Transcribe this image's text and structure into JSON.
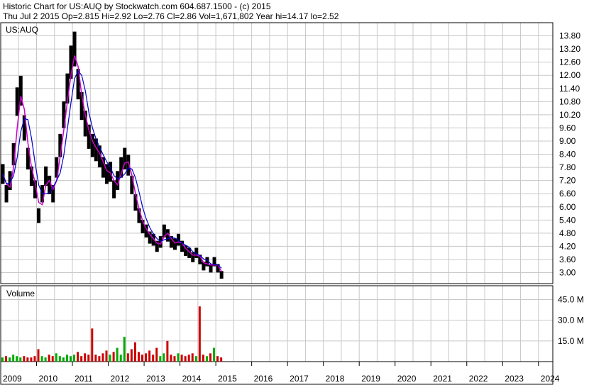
{
  "header": {
    "line1": "Historic Chart for US:AUQ by Stockwatch.com 604.687.1500 - (c) 2015",
    "line2": "Thu Jul  2 2015   Op=2.815   Hi=2.92   Lo=2.76   Cl=2.86   Vol=1,671,802   Year hi=14.17   lo=2.52"
  },
  "price_panel": {
    "symbol_label": "US:AUQ"
  },
  "volume_panel": {
    "title": "Volume"
  },
  "colors": {
    "price_bars": "#000000",
    "moving_average_short": "#cc00cc",
    "moving_average_long": "#0000cc",
    "volume_up": "#00aa00",
    "volume_down": "#cc0000",
    "grid": "#c8c8c8"
  },
  "chart_data": [
    {
      "type": "line",
      "panel": "price",
      "y_ticks": [
        "13.80",
        "13.20",
        "12.60",
        "12.00",
        "11.40",
        "10.80",
        "10.20",
        "9.60",
        "9.00",
        "8.40",
        "7.80",
        "7.20",
        "6.60",
        "6.00",
        "5.40",
        "4.80",
        "4.20",
        "3.60",
        "3.00"
      ],
      "ylim": [
        2.5,
        14.4
      ],
      "x_ticks": [
        "2009",
        "2010",
        "2011",
        "2012",
        "2013",
        "2014",
        "2015",
        "2016",
        "2017",
        "2018",
        "2019",
        "2020",
        "2021",
        "2022",
        "2023",
        "2024"
      ],
      "xlim": [
        2009.0,
        2024.4
      ],
      "grid": true,
      "series": [
        {
          "x": [
            2009.0,
            2009.1,
            2009.2,
            2009.3,
            2009.4,
            2009.5,
            2009.6,
            2009.7,
            2009.8,
            2009.9,
            2010.0,
            2010.1,
            2010.2,
            2010.3,
            2010.4,
            2010.5,
            2010.6,
            2010.7,
            2010.8,
            2010.9,
            2011.0,
            2011.1,
            2011.2,
            2011.3,
            2011.4,
            2011.5,
            2011.6,
            2011.7,
            2011.8,
            2011.9,
            2012.0,
            2012.1,
            2012.2,
            2012.3,
            2012.4,
            2012.5,
            2012.6,
            2012.7,
            2012.8,
            2012.9,
            2013.0,
            2013.1,
            2013.2,
            2013.3,
            2013.4,
            2013.5,
            2013.6,
            2013.7,
            2013.8,
            2013.9,
            2014.0,
            2014.1,
            2014.2,
            2014.3,
            2014.4,
            2014.5,
            2014.6,
            2014.7,
            2014.8,
            2014.9,
            2015.0,
            2015.1
          ],
          "values": [
            7.5,
            6.6,
            7.2,
            8.4,
            10.8,
            11.3,
            9.6,
            8.2,
            7.4,
            6.8,
            5.6,
            6.6,
            7.4,
            7.0,
            6.6,
            7.8,
            8.8,
            10.2,
            11.4,
            12.6,
            13.2,
            11.6,
            10.6,
            9.8,
            9.2,
            8.8,
            8.6,
            8.3,
            7.8,
            7.5,
            7.6,
            6.8,
            7.2,
            7.8,
            8.2,
            7.9,
            7.0,
            6.2,
            5.6,
            5.1,
            4.9,
            4.6,
            4.5,
            4.2,
            4.4,
            4.9,
            4.7,
            4.4,
            4.3,
            4.5,
            4.2,
            4.0,
            3.9,
            3.7,
            3.9,
            3.6,
            3.3,
            3.5,
            3.2,
            3.5,
            3.2,
            2.9
          ]
        }
      ]
    },
    {
      "type": "bar",
      "panel": "volume",
      "y_ticks": [
        "45.0 M",
        "30.0 M",
        "15.0 M"
      ],
      "ylim": [
        0,
        55
      ],
      "x": [
        2009.0,
        2009.1,
        2009.2,
        2009.3,
        2009.4,
        2009.5,
        2009.6,
        2009.7,
        2009.8,
        2009.9,
        2010.0,
        2010.1,
        2010.2,
        2010.3,
        2010.4,
        2010.5,
        2010.6,
        2010.7,
        2010.8,
        2010.9,
        2011.0,
        2011.1,
        2011.2,
        2011.3,
        2011.4,
        2011.5,
        2011.6,
        2011.7,
        2011.8,
        2011.9,
        2012.0,
        2012.1,
        2012.2,
        2012.3,
        2012.4,
        2012.5,
        2012.6,
        2012.7,
        2012.8,
        2012.9,
        2013.0,
        2013.1,
        2013.2,
        2013.3,
        2013.4,
        2013.5,
        2013.6,
        2013.7,
        2013.8,
        2013.9,
        2014.0,
        2014.1,
        2014.2,
        2014.3,
        2014.4,
        2014.5,
        2014.6,
        2014.7,
        2014.8,
        2014.9,
        2015.0,
        2015.1
      ],
      "values": [
        3,
        4,
        3,
        5,
        4,
        3,
        4,
        3,
        3,
        4,
        9,
        4,
        3,
        5,
        4,
        6,
        4,
        3,
        5,
        4,
        5,
        7,
        4,
        6,
        5,
        24,
        5,
        4,
        6,
        8,
        5,
        7,
        10,
        5,
        18,
        6,
        9,
        14,
        7,
        5,
        6,
        8,
        5,
        10,
        4,
        6,
        15,
        5,
        4,
        6,
        5,
        4,
        5,
        6,
        4,
        40,
        5,
        4,
        6,
        10,
        4,
        3
      ]
    }
  ]
}
